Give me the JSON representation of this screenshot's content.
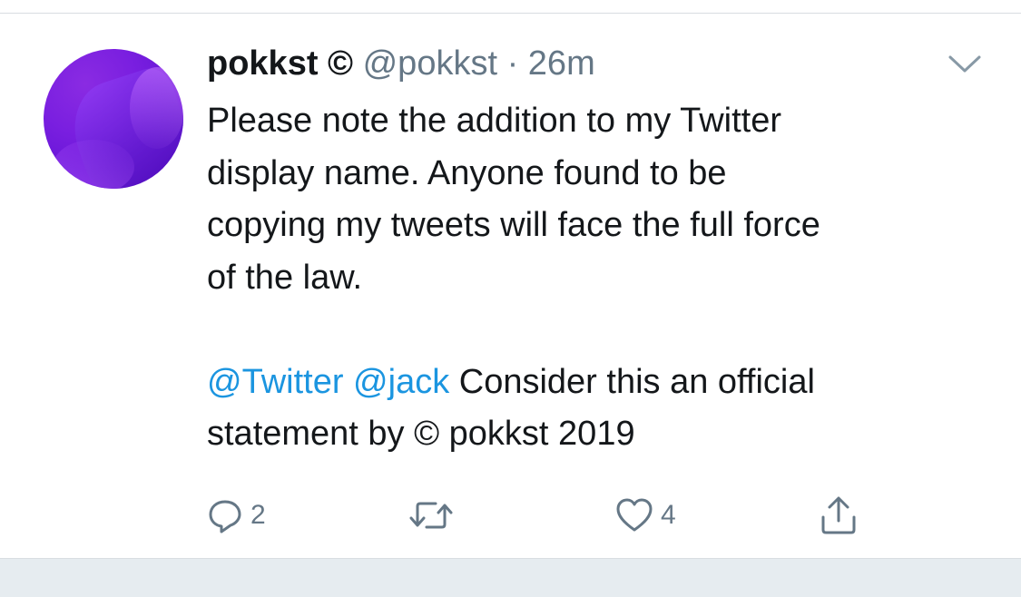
{
  "tweet": {
    "display_name": "pokkst ©",
    "handle": "@pokkst",
    "separator": "·",
    "timestamp": "26m",
    "text_line1": "Please note the addition to my Twitter",
    "text_line2": "display name. Anyone found to be",
    "text_line3": "copying my tweets will face the full force",
    "text_line4": "of the law.",
    "mention1": "@Twitter",
    "mention2": "@jack",
    "text_after_mentions": "Consider this an official",
    "text_last_line": "statement by © pokkst 2019",
    "mention_color": "#1b95e0"
  },
  "actions": {
    "reply_count": "2",
    "retweet_count": "",
    "like_count": "4",
    "icons": [
      "reply-icon",
      "retweet-icon",
      "like-icon",
      "share-icon"
    ]
  },
  "menu": {
    "icon": "chevron-down-icon"
  }
}
